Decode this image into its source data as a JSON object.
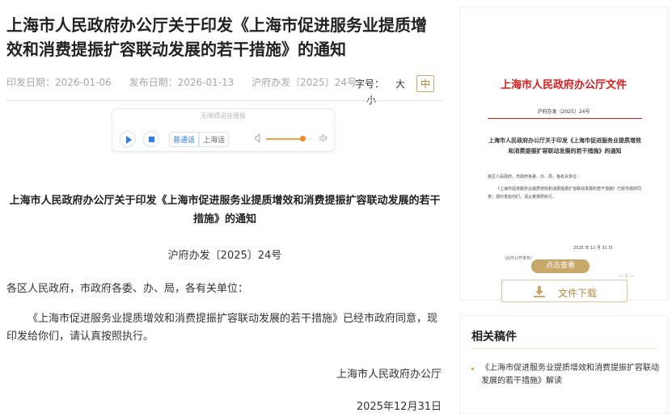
{
  "article": {
    "title": "上海市人民政府办公厅关于印发《上海市促进服务业提质增效和消费提振扩容联动发展的若干措施》的通知",
    "print_date": "印发日期：2026-01-06",
    "publish_date": "发布日期：2026-01-13",
    "doc_number_meta": "沪府办发〔2025〕24号",
    "font_size_label": "字号：",
    "font_sizes": [
      "大",
      "中",
      "小"
    ],
    "active_font_size": "中"
  },
  "player": {
    "title": "无障碍语音播报",
    "languages": [
      "普通话",
      "上海话"
    ],
    "volume_percent": 78,
    "accent_color": "#2b7de9",
    "volume_color": "#f1a341"
  },
  "document": {
    "heading": "上海市人民政府办公厅关于印发《上海市促进服务业提质增效和消费提振扩容联动发展的若干措施》的通知",
    "doc_number": "沪府办发〔2025〕24号",
    "addressee": "各区人民政府，市政府各委、办、局，各有关单位：",
    "body": "《上海市促进服务业提质增效和消费提振扩容联动发展的若干措施》已经市政府同意，现印发给你们，请认真按照执行。",
    "issuer": "上海市人民政府办公厅",
    "date": "2025年12月31日"
  },
  "preview": {
    "header_title": "上海市人民政府办公厅文件",
    "doc_number": "沪府办发〔2025〕24号",
    "heading": "上海市人民政府办公厅关于印发《上海市促进服务业提质增效和消费提振扩容联动发展的若干措施》的通知",
    "addressee": "各区人民政府，市政府各委、办、局，各有关单位：",
    "body": "《上海市促进服务业提质增效和消费提振扩容联动发展的若干措施》已经市政府同意，现印发给你们，请认真按照执行。",
    "date": "2025 年 12 月 31 日",
    "note": "（此件公开发布）",
    "page": "— 1 —",
    "view_button": "点击查看",
    "download_button": "文件下载",
    "red_color": "#d42020",
    "gold_color": "#c7a76a"
  },
  "related": {
    "title": "相关稿件",
    "items": [
      "《上海市促进服务业提质增效和消费提振扩容联动发展的若干措施》解读"
    ]
  }
}
